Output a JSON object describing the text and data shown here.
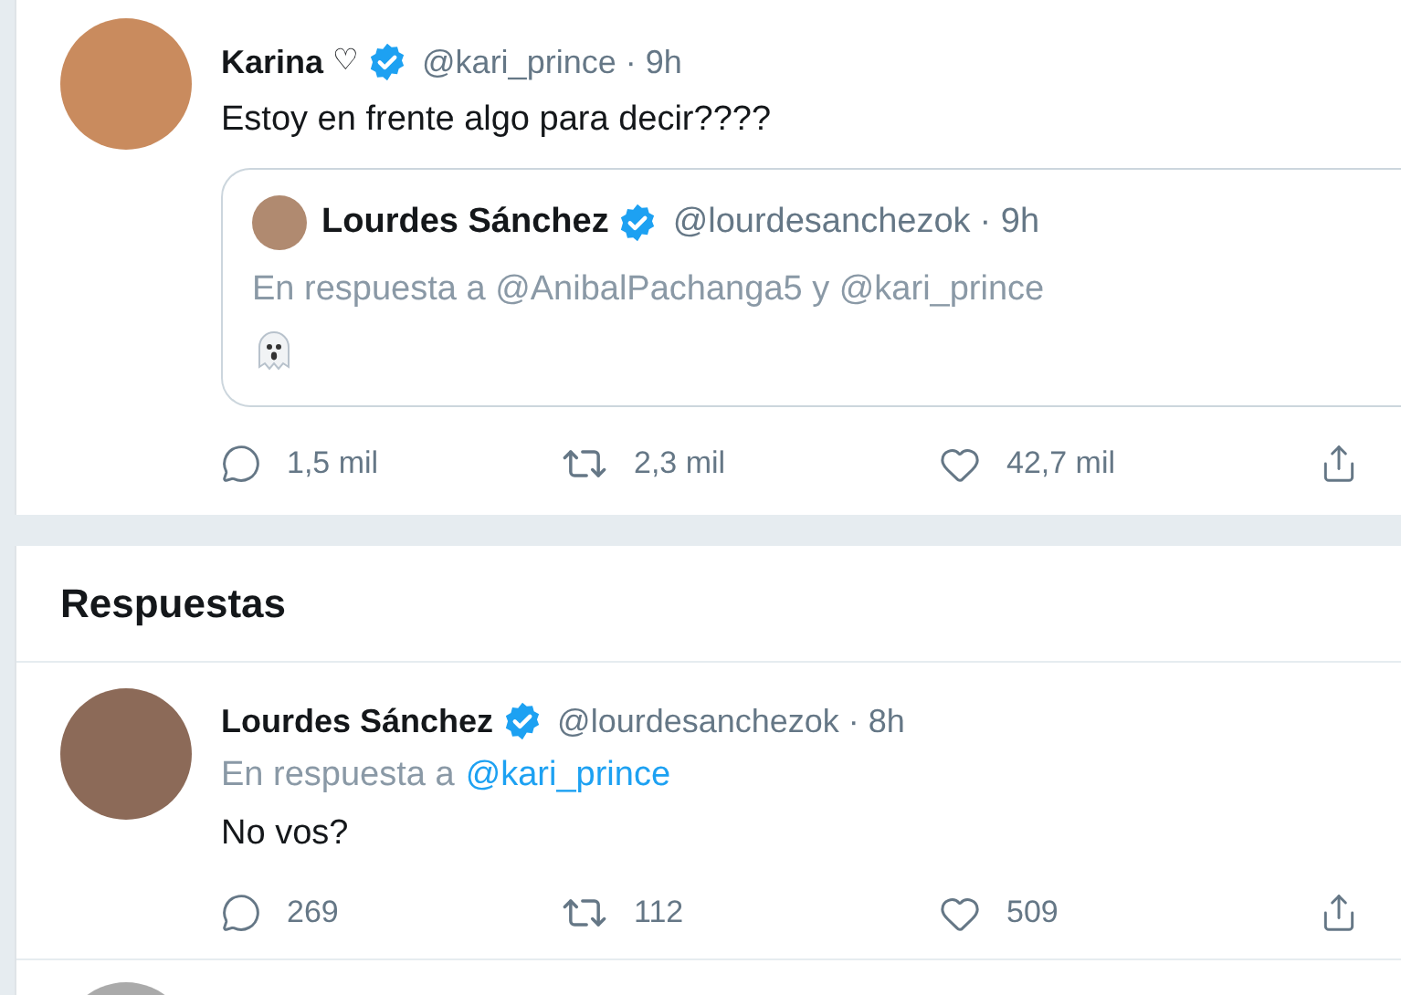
{
  "tweet": {
    "author": {
      "name": "Karina",
      "name_suffix": "♡",
      "verified": true,
      "handle": "@kari_prince",
      "time": "· 9h"
    },
    "text": "Estoy en frente algo para decir????",
    "quoted": {
      "author": {
        "name": "Lourdes Sánchez",
        "verified": true,
        "handle": "@lourdesanchezok",
        "time": "· 9h"
      },
      "reply_to_text": "En respuesta a @AnibalPachanga5 y @kari_prince"
    },
    "actions": [
      {
        "kind": "reply",
        "count": "1,5 mil"
      },
      {
        "kind": "retweet",
        "count": "2,3 mil"
      },
      {
        "kind": "like",
        "count": "42,7 mil"
      },
      {
        "kind": "share"
      }
    ]
  },
  "replies_heading": "Respuestas",
  "replies": [
    {
      "author": {
        "name": "Lourdes Sánchez",
        "verified": true,
        "handle": "@lourdesanchezok",
        "time": "· 8h"
      },
      "reply_to": {
        "prefix": "En respuesta a",
        "mention": "@kari_prince"
      },
      "text": "No vos?",
      "actions": [
        {
          "kind": "reply",
          "count": "269"
        },
        {
          "kind": "retweet",
          "count": "112"
        },
        {
          "kind": "like",
          "count": "509"
        },
        {
          "kind": "share"
        }
      ]
    }
  ]
}
